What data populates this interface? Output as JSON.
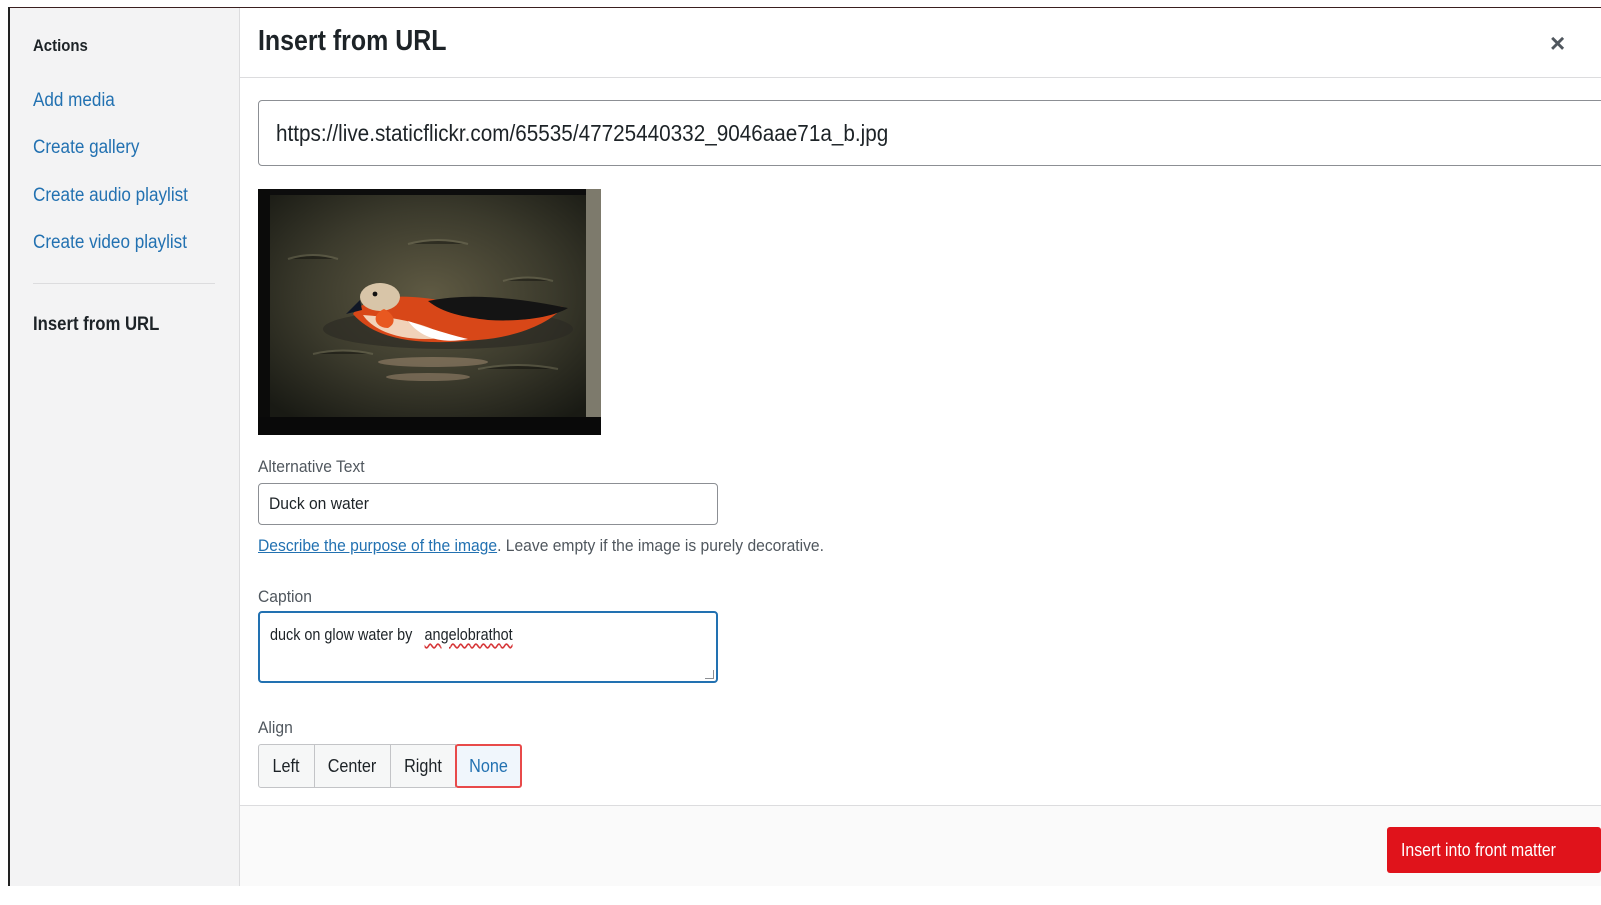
{
  "sidebar": {
    "heading": "Actions",
    "items": [
      {
        "label": "Add media"
      },
      {
        "label": "Create gallery"
      },
      {
        "label": "Create audio playlist"
      },
      {
        "label": "Create video playlist"
      }
    ],
    "active_item": "Insert from URL"
  },
  "modal": {
    "title": "Insert from URL",
    "close_icon": "close-icon",
    "url_value": "https://live.staticflickr.com/65535/47725440332_9046aae71a_b.jpg",
    "preview_icon": "duck-photo"
  },
  "alt_text": {
    "label": "Alternative Text",
    "value": "Duck on water",
    "help_link": "Describe the purpose of the image",
    "help_text": ". Leave empty if the image is purely decorative."
  },
  "caption": {
    "label": "Caption",
    "value_start": "duck on glow water by ",
    "value_misspelled": "angelobrathot"
  },
  "align": {
    "label": "Align",
    "options": [
      "Left",
      "Center",
      "Right",
      "None"
    ],
    "selected": "None"
  },
  "footer": {
    "insert_label": "Insert into front matter"
  },
  "colors": {
    "link": "#2271b1",
    "primary_button": "#e0131b",
    "selected_outline": "#e84a4a"
  }
}
